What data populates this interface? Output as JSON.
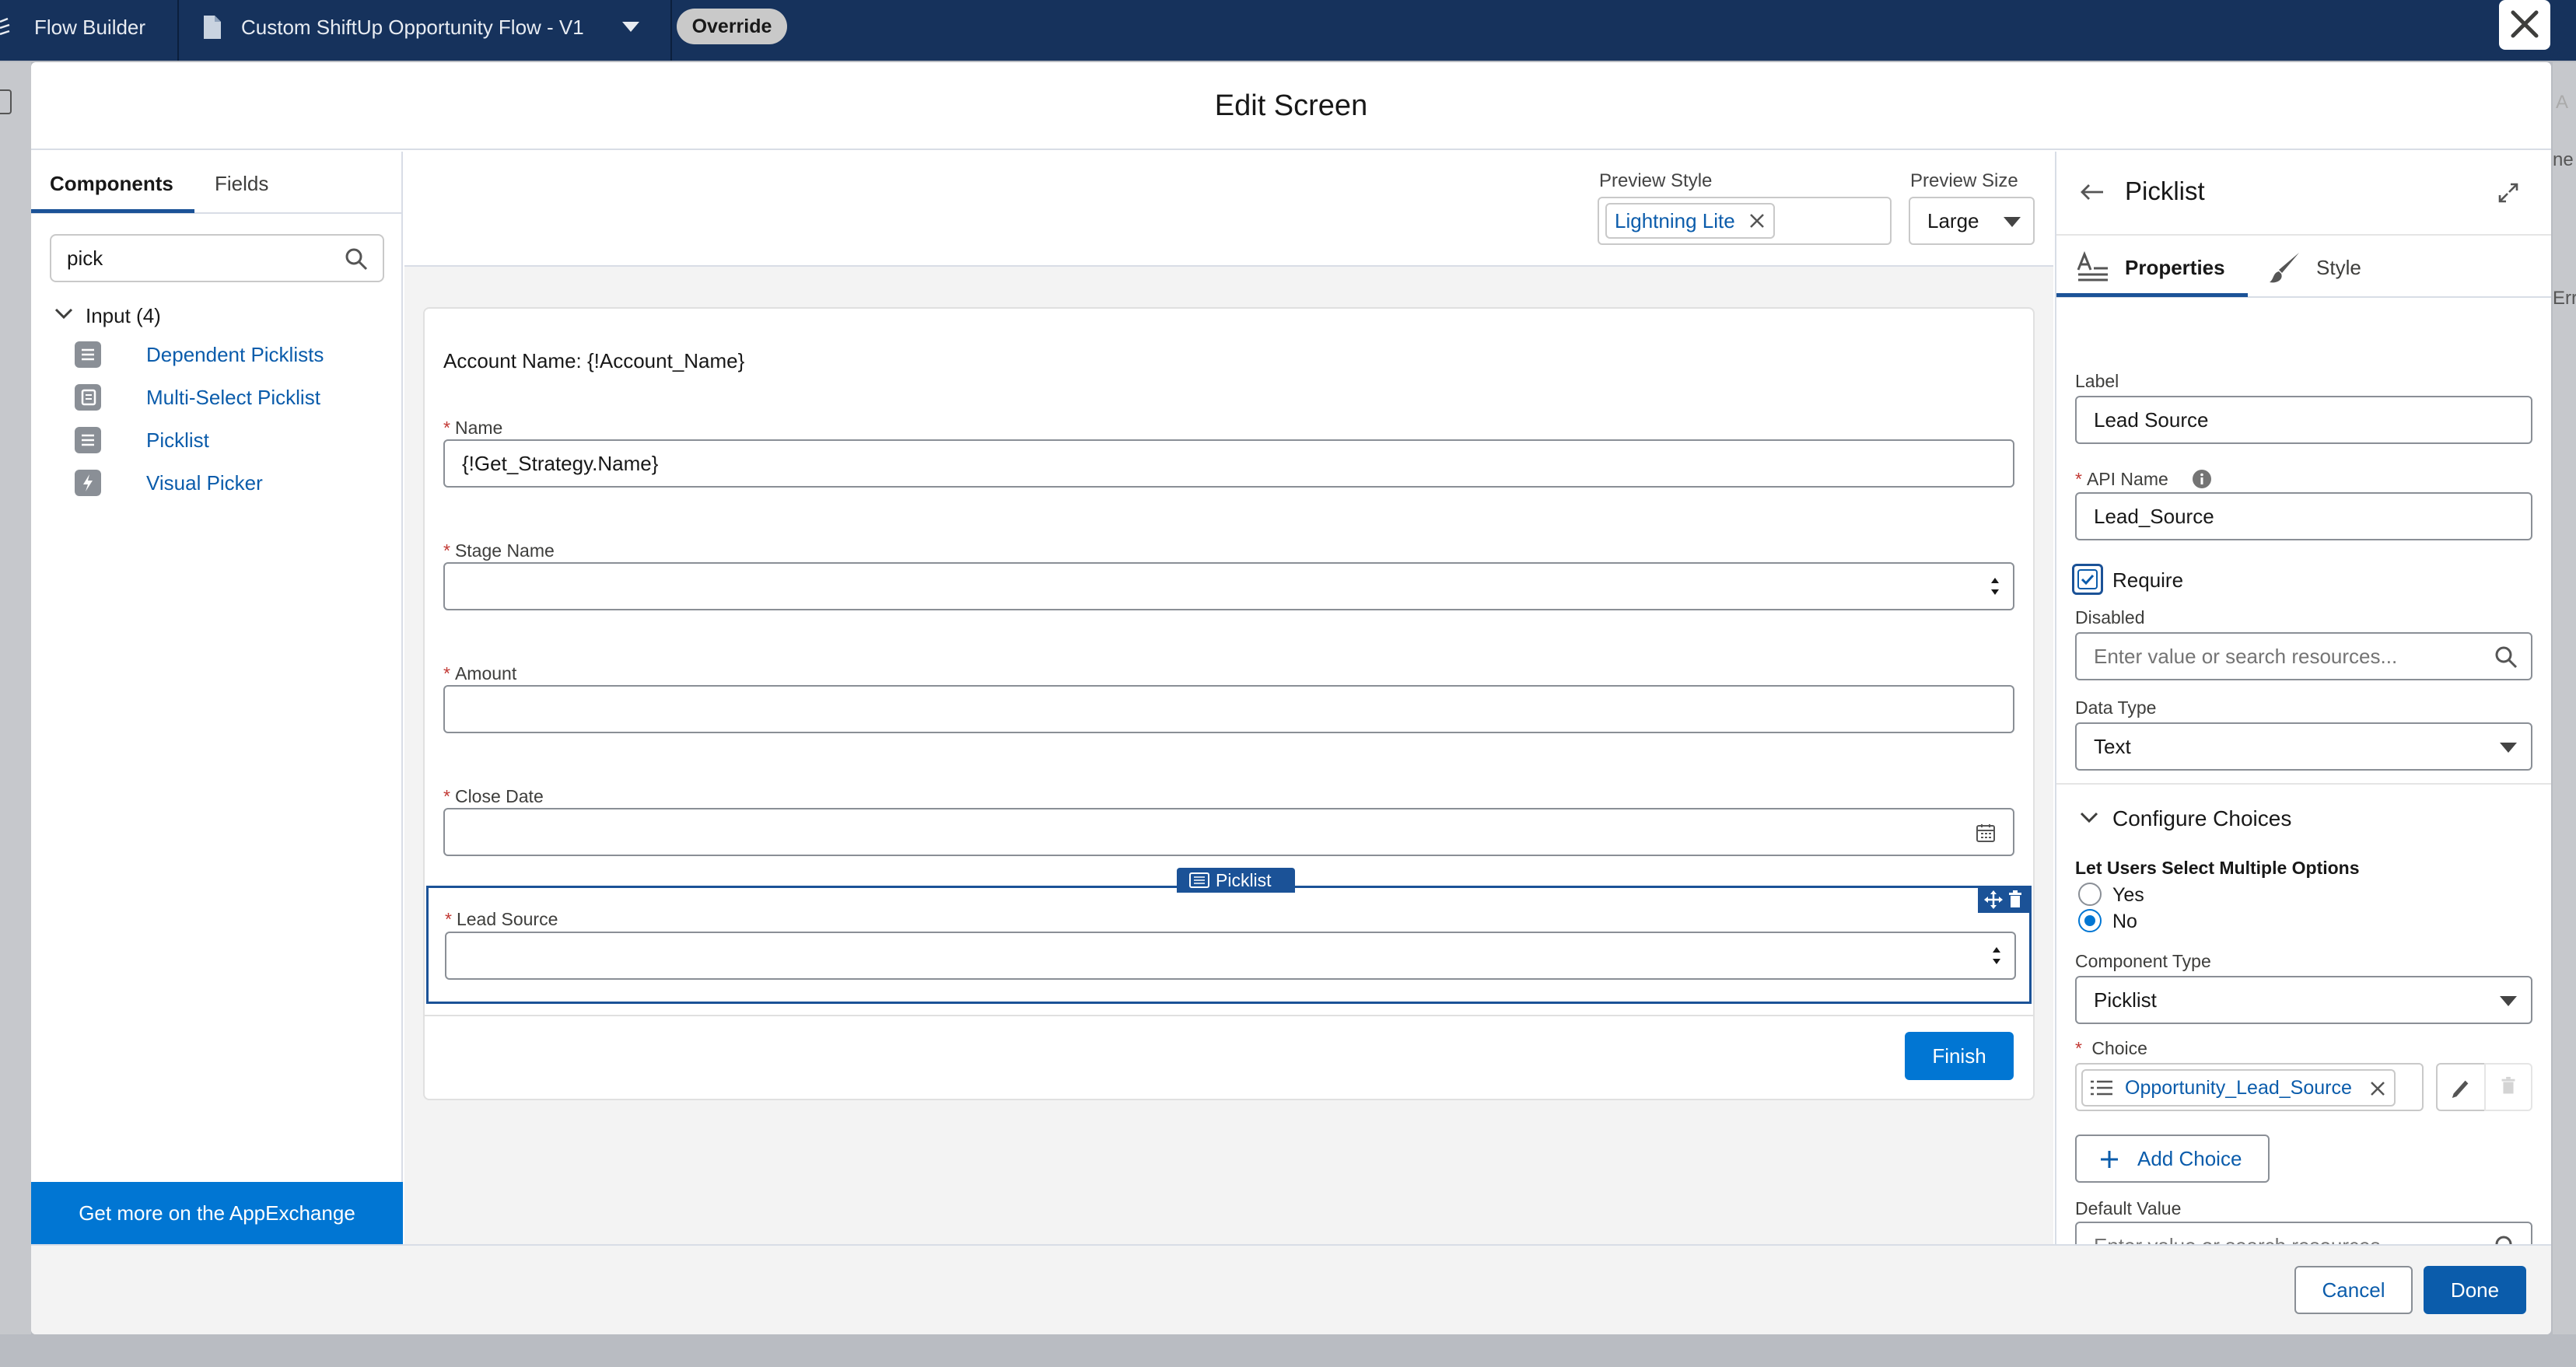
{
  "topbar": {
    "app_name": "Flow Builder",
    "flow_title": "Custom ShiftUp Opportunity Flow - V1",
    "badge": "Override"
  },
  "modal": {
    "title": "Edit Screen",
    "left_panel": {
      "tabs": [
        "Components",
        "Fields"
      ],
      "active_tab": "Components",
      "search_value": "pick",
      "group_label": "Input (4)",
      "components": [
        "Dependent Picklists",
        "Multi-Select Picklist",
        "Picklist",
        "Visual Picker"
      ],
      "appexchange_label": "Get more on the AppExchange"
    },
    "canvas": {
      "preview_style_label": "Preview Style",
      "preview_style_value": "Lightning Lite",
      "preview_size_label": "Preview Size",
      "preview_size_value": "Large",
      "account_text": "Account Name: {!Account_Name}",
      "fields": [
        {
          "label": "Name",
          "value": "{!Get_Strategy.Name}"
        },
        {
          "label": "Stage Name",
          "value": ""
        },
        {
          "label": "Amount",
          "value": ""
        },
        {
          "label": "Close Date",
          "value": ""
        },
        {
          "label": "Lead Source",
          "value": ""
        }
      ],
      "selected_tag": "Picklist",
      "finish_label": "Finish"
    },
    "right_panel": {
      "title": "Picklist",
      "tabs": [
        "Properties",
        "Style"
      ],
      "active_tab": "Properties",
      "label_label": "Label",
      "label_value": "Lead Source",
      "api_label": "API Name",
      "api_value": "Lead_Source",
      "require_label": "Require",
      "require_checked": true,
      "disabled_label": "Disabled",
      "disabled_placeholder": "Enter value or search resources...",
      "data_type_label": "Data Type",
      "data_type_value": "Text",
      "configure_title": "Configure Choices",
      "multi_label": "Let Users Select Multiple Options",
      "multi_yes": "Yes",
      "multi_no": "No",
      "multi_selected": "No",
      "component_type_label": "Component Type",
      "component_type_value": "Picklist",
      "choice_label": "Choice",
      "choice_value": "Opportunity_Lead_Source",
      "add_choice_label": "Add Choice",
      "default_value_label": "Default Value",
      "default_value_placeholder": "Enter value or search resources..."
    },
    "footer": {
      "cancel_label": "Cancel",
      "done_label": "Done"
    }
  },
  "background_edge": {
    "right_texts": [
      "A",
      "ne",
      "Err"
    ]
  },
  "colors": {
    "brand_blue": "#0176d3",
    "navy": "#16325c",
    "link": "#0b5cab",
    "required": "#c23934"
  }
}
